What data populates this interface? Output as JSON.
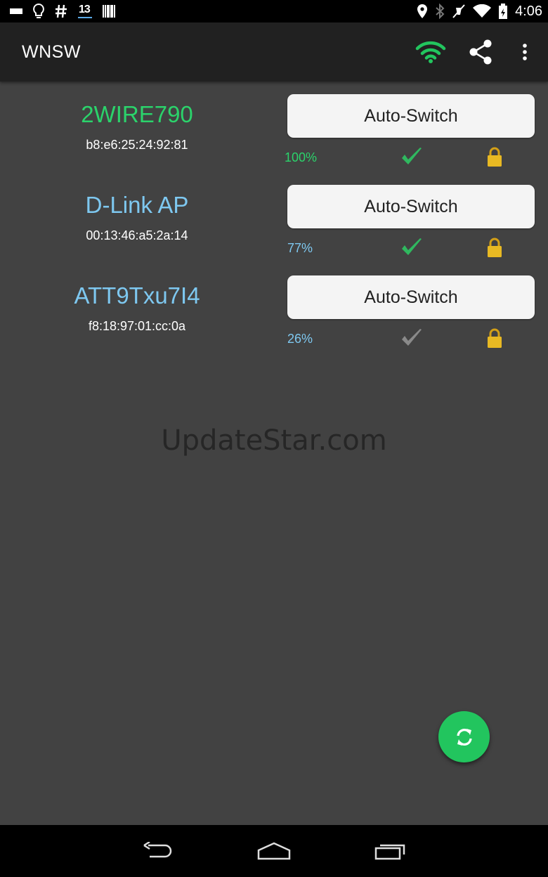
{
  "status_bar": {
    "time": "4:06",
    "left_icons": [
      "battery-saver-icon",
      "lightbulb-icon",
      "hashtag-icon",
      "calendar-13-icon",
      "barcode-icon"
    ],
    "calendar_day": "13",
    "right_icons": [
      "location-icon",
      "bluetooth-icon",
      "mute-icon",
      "wifi-icon",
      "battery-icon"
    ]
  },
  "app_bar": {
    "title": "WNSW",
    "actions": [
      "wifi-status-icon",
      "share-icon",
      "overflow-menu-icon"
    ],
    "wifi_color": "#22c55e"
  },
  "networks": [
    {
      "ssid": "2WIRE790",
      "mac": "b8:e6:25:24:92:81",
      "button_label": "Auto-Switch",
      "signal": "100%",
      "connected": true,
      "secured": true,
      "color": "#2bd36b"
    },
    {
      "ssid": "D-Link AP",
      "mac": "00:13:46:a5:2a:14",
      "button_label": "Auto-Switch",
      "signal": "77%",
      "connected": true,
      "secured": true,
      "color": "#7ec8f0"
    },
    {
      "ssid": "ATT9Txu7I4",
      "mac": "f8:18:97:01:cc:0a",
      "button_label": "Auto-Switch",
      "signal": "26%",
      "connected": false,
      "secured": true,
      "color": "#7ec8f0"
    }
  ],
  "watermark": "UpdateStar.com",
  "fab": {
    "icon": "refresh-icon",
    "color": "#22c55e"
  },
  "nav_bar": [
    "back-icon",
    "home-icon",
    "recents-icon"
  ]
}
